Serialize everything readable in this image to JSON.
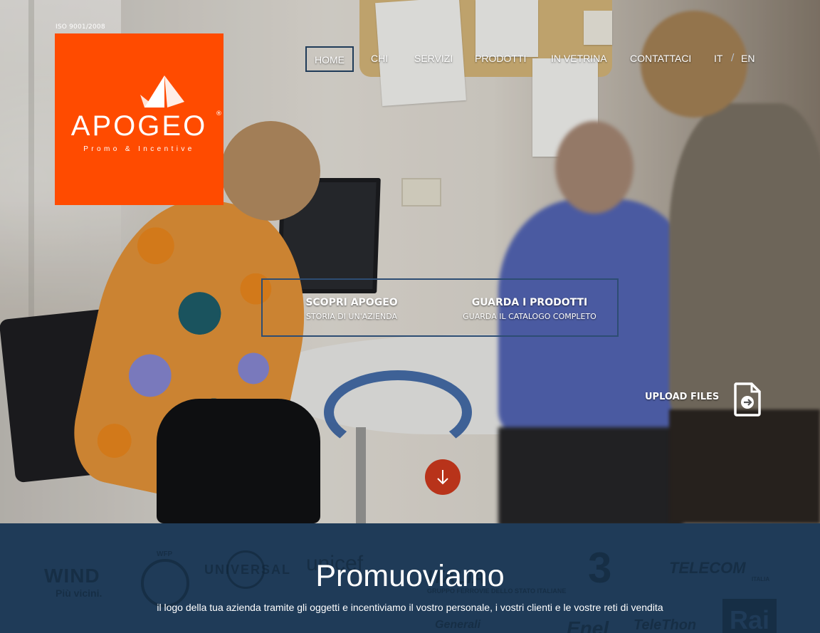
{
  "header": {
    "certification": "ISO 9001/2008",
    "logo": {
      "brand": "APOGEO",
      "registered_mark": "®",
      "tagline": "Promo & Incentive",
      "background_color": "#ff4b00"
    },
    "nav": {
      "items": [
        {
          "label": "HOME",
          "active": true
        },
        {
          "label": "CHI"
        },
        {
          "label": "SERVIZI"
        },
        {
          "label": "PRODOTTI"
        },
        {
          "label": "IN VETRINA"
        },
        {
          "label": "CONTATTACI"
        }
      ],
      "languages": [
        "IT",
        "EN"
      ],
      "language_separator": "/"
    }
  },
  "hero": {
    "cta": [
      {
        "title": "SCOPRI APOGEO",
        "subtitle": "Storia di un'azienda"
      },
      {
        "title": "GUARDA I PRODOTTI",
        "subtitle": "Guarda il catalogo completo"
      }
    ],
    "upload": {
      "label": "UPLOAD FILES",
      "icon": "file-arrow-icon"
    },
    "scroll_down": {
      "icon": "arrow-down-icon",
      "color": "#b8331a"
    }
  },
  "band": {
    "background_color": "#1f3b58",
    "title": "Promuoviamo",
    "subtitle": "il logo della tua azienda tramite gli oggetti e incentiviamo il vostro personale, i vostri clienti e le vostre reti di vendita",
    "client_logos": {
      "wind": "WIND",
      "wind_sub": "Più vicini.",
      "wfp": "WFP",
      "universal": "UNIVERSAL",
      "unicef": "unicef",
      "italia": "ITALIA",
      "italia_sub": "GRUPPO FERROVIE DELLO STATO ITALIANE",
      "three": "3",
      "telecom": "TELECOM",
      "telecom_sub": "ITALIA",
      "rai": "Rai",
      "enel": "Enel",
      "telethon": "TeleThon",
      "generali": "Generali"
    }
  }
}
